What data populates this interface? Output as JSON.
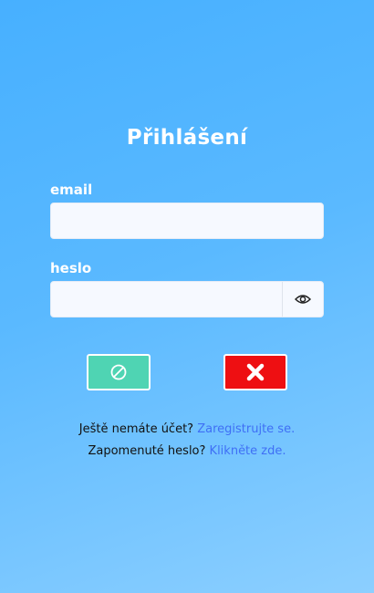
{
  "page": {
    "title": "Přihlášení"
  },
  "form": {
    "email_label": "email",
    "email_value": "",
    "email_placeholder": "",
    "password_label": "heslo",
    "password_value": "",
    "password_placeholder": ""
  },
  "icons": {
    "toggle_password": "eye-icon",
    "submit": "prohibited-icon",
    "cancel": "close-icon"
  },
  "links": {
    "register_prompt": "Ještě nemáte účet?",
    "register_link": "Zaregistrujte se.",
    "forgot_prompt": "Zapomenuté heslo?",
    "forgot_link": "Klikněte zde."
  },
  "colors": {
    "background_top": "#47b0ff",
    "background_bottom": "#8ccfff",
    "submit_button": "#4fd4b3",
    "cancel_button": "#ee0f12",
    "link": "#3f6ff5"
  }
}
